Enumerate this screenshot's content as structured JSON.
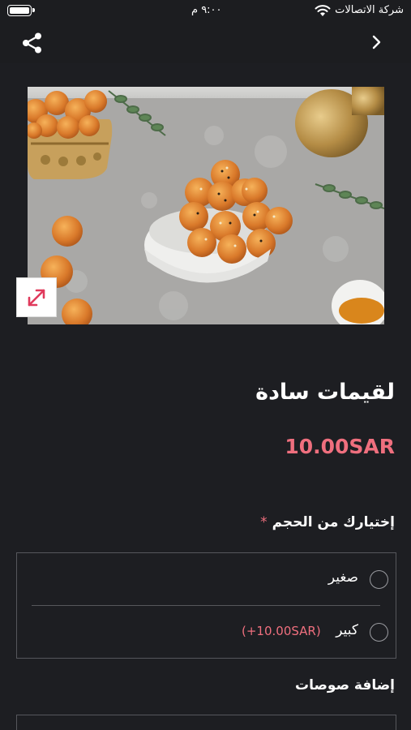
{
  "status_bar": {
    "carrier": "شركة الاتصالات",
    "time": "٩:٠٠ م"
  },
  "nav": {
    "share_icon": "share-icon",
    "back_icon": "chevron-right-icon"
  },
  "product": {
    "title": "لقيمات سادة",
    "price": "10.00SAR",
    "expand_icon": "expand-icon"
  },
  "size": {
    "label": "إختيارك من الحجم",
    "required_mark": "*",
    "options": [
      {
        "label": "صغير",
        "extra": ""
      },
      {
        "label": "كبير",
        "extra": "(+10.00SAR)"
      }
    ]
  },
  "sauces": {
    "label": "إضافة صوصات"
  },
  "colors": {
    "background": "#1d1e22",
    "accent": "#ef6f7e",
    "border": "#56575c"
  }
}
